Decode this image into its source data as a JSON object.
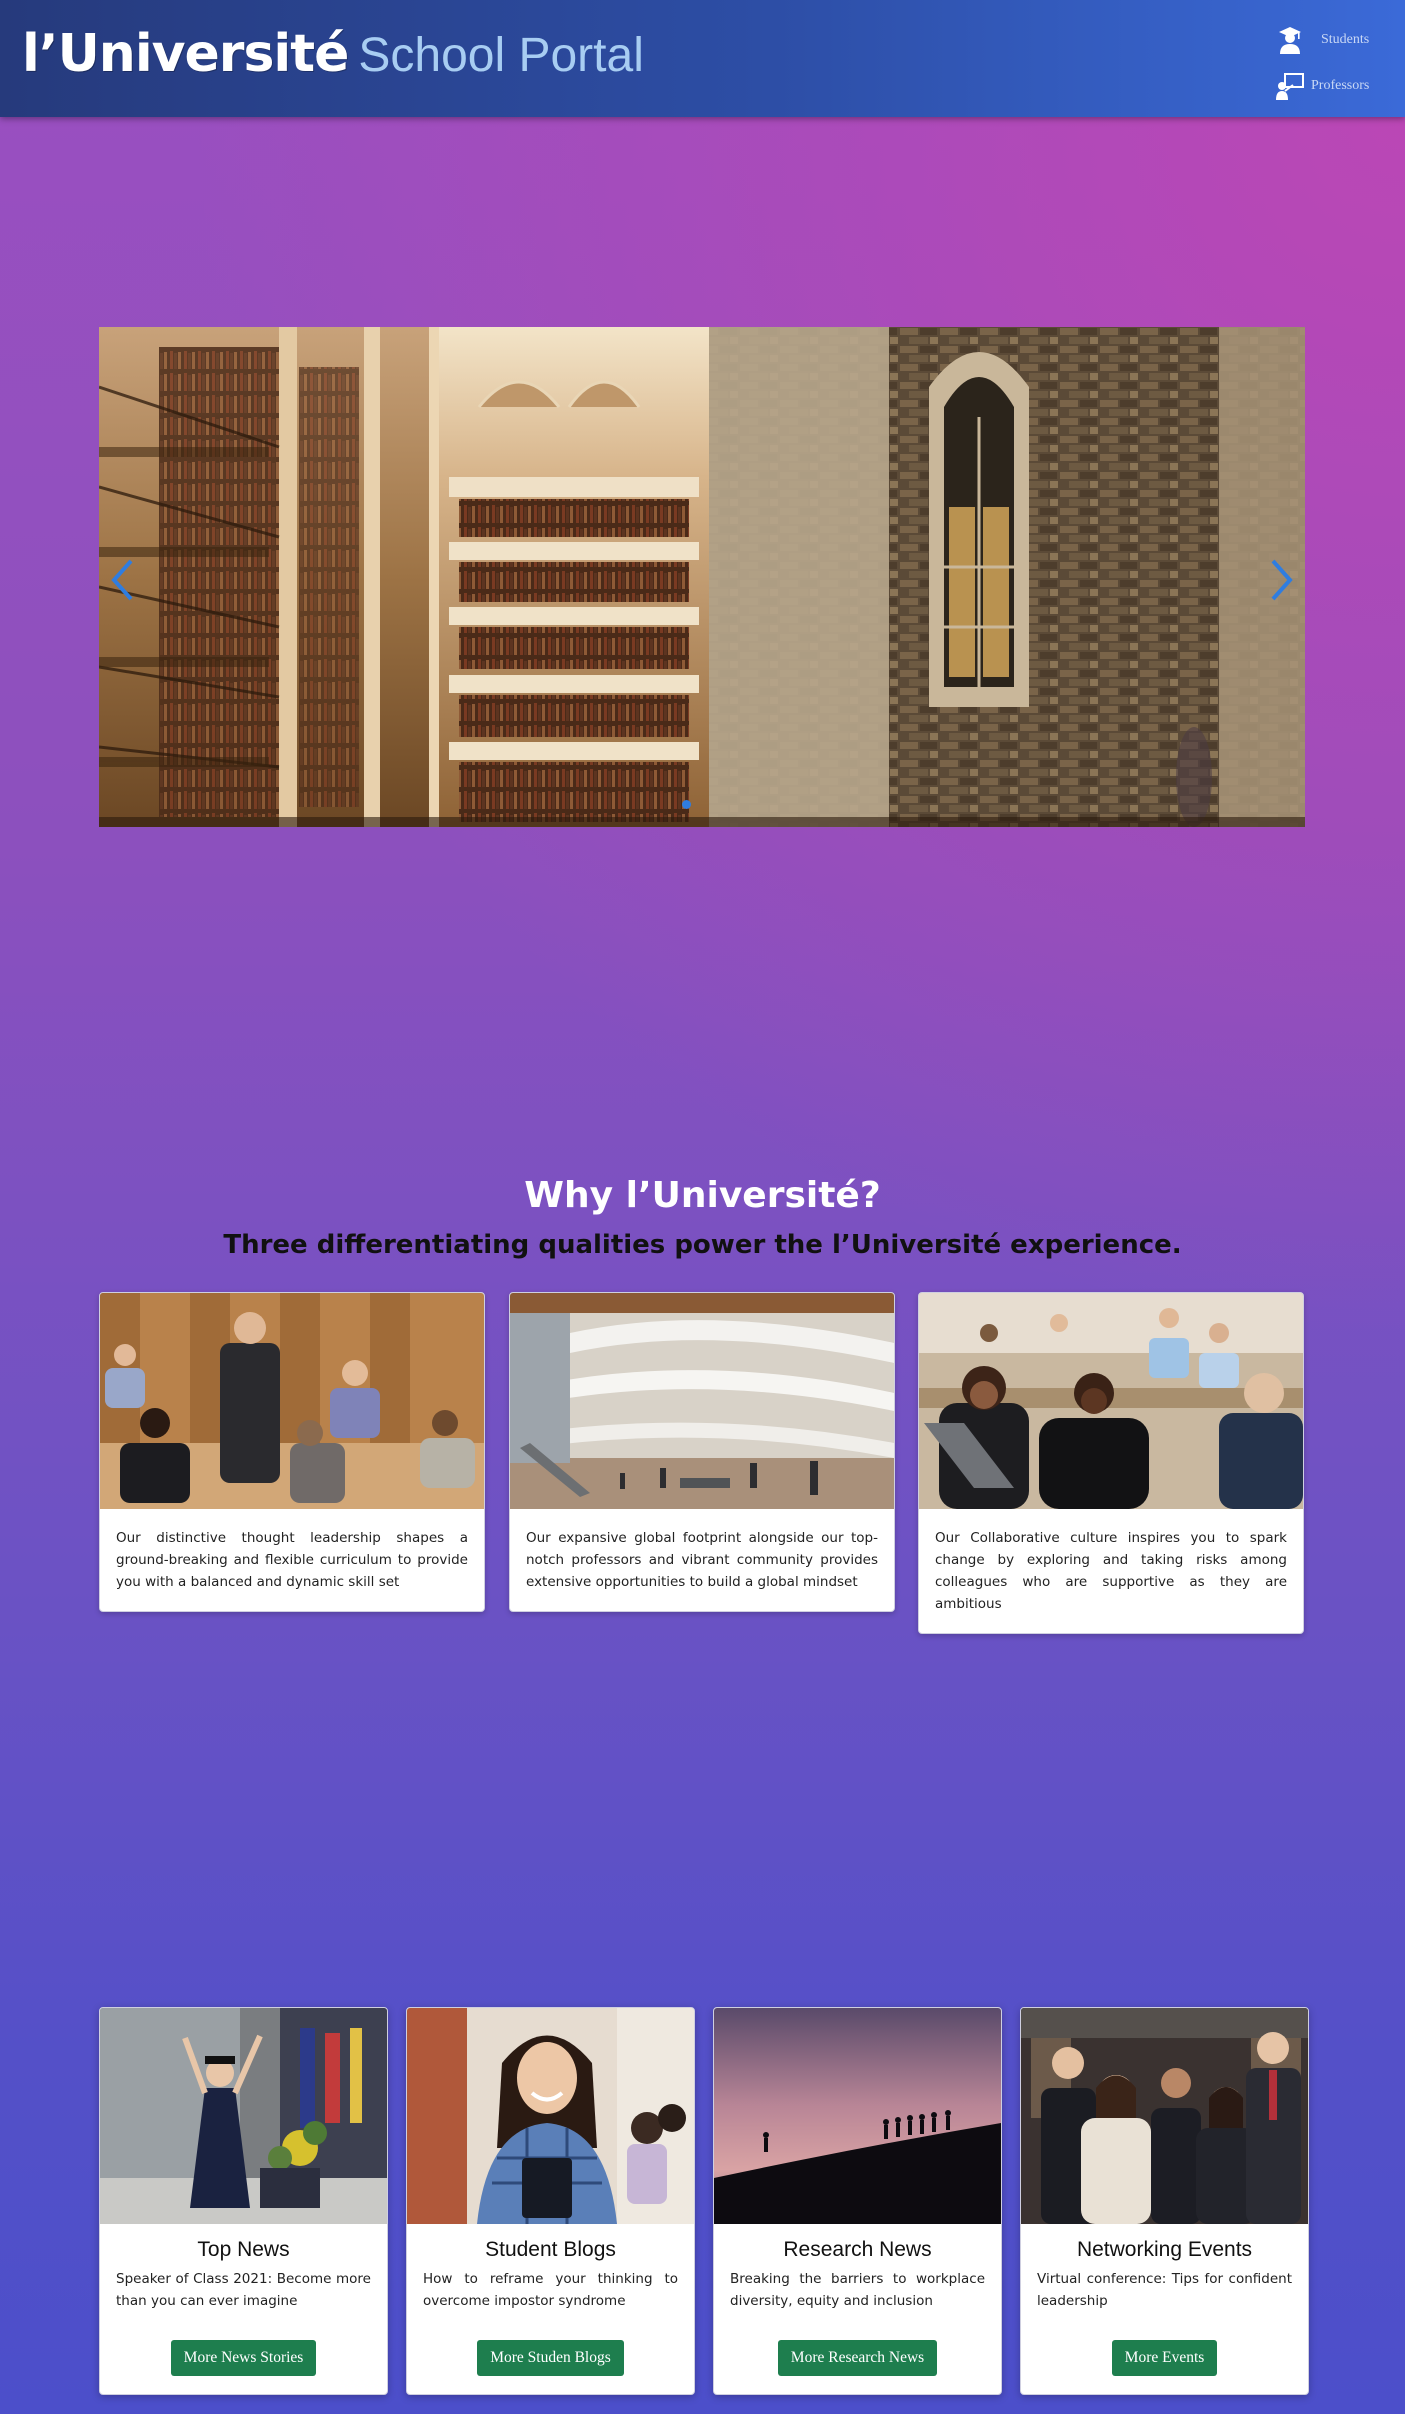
{
  "header": {
    "brand_name": "l’Université",
    "brand_portal": "School Portal",
    "nav": [
      {
        "label": "Students",
        "icon": "student-icon"
      },
      {
        "label": "Professors",
        "icon": "professor-icon"
      }
    ]
  },
  "carousel": {
    "image": "library-campus-photo",
    "prev_icon": "chevron-left-icon",
    "next_icon": "chevron-right-icon",
    "active_slide": 1
  },
  "why": {
    "title": "Why l’Université?",
    "subtitle": "Three differentiating qualities power the l’Université experience.",
    "cards": [
      {
        "image": "classroom-lecture-photo",
        "text": "Our distinctive thought leadership shapes a ground-breaking and flexible curriculum to provide you with a balanced and dynamic skill set"
      },
      {
        "image": "campus-atrium-photo",
        "text": "Our expansive global footprint alongside our top-notch professors and vibrant community provides extensive opportunities to build a global mindset"
      },
      {
        "image": "student-discussion-photo",
        "text": "Our Collaborative culture inspires you to spark change by exploring and taking risks among colleagues who are supportive as they are ambitious"
      }
    ]
  },
  "news": [
    {
      "title": "Top News",
      "text": "Speaker of Class 2021: Become more than you can ever imagine",
      "button": "More News Stories",
      "image": "graduate-celebration-photo"
    },
    {
      "title": "Student Blogs",
      "text": "How to reframe your thinking to overcome impostor syndrome",
      "button": "More Studen Blogs",
      "image": "student-portrait-photo"
    },
    {
      "title": "Research News",
      "text": "Breaking the barriers to workplace diversity, equity and inclusion",
      "button": "More Research News",
      "image": "hill-silhouette-photo"
    },
    {
      "title": "Networking Events",
      "text": "Virtual conference: Tips for confident leadership",
      "button": "More Events",
      "image": "professionals-group-photo"
    }
  ],
  "colors": {
    "header_start": "#263a7c",
    "header_end": "#3b6ad8",
    "brand_portal": "#a8cdf2",
    "button_green": "#1e7e4e",
    "background_top": "#9b4fc0",
    "background_bottom": "#4c4fca"
  }
}
